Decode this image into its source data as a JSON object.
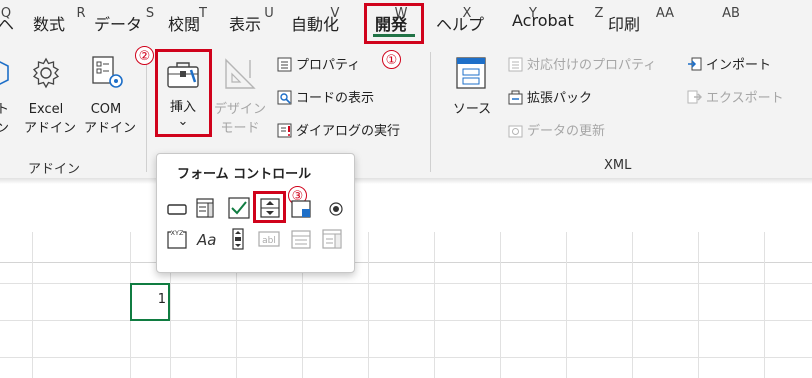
{
  "tabs": [
    {
      "label": "ヘ"
    },
    {
      "label": "数式"
    },
    {
      "label": "データ"
    },
    {
      "label": "校閲"
    },
    {
      "label": "表示"
    },
    {
      "label": "自動化"
    },
    {
      "label": "開発",
      "active": true
    },
    {
      "label": "ヘルプ"
    },
    {
      "label": "Acrobat"
    },
    {
      "label": "印刷"
    }
  ],
  "ribbon": {
    "addins_group": {
      "excel_addin": "Excel",
      "excel_addin_line2": "アドイン",
      "com_addin": "COM",
      "com_addin_line2": "アドイン",
      "label": "アドイン"
    },
    "controls_group": {
      "insert_label": "挿入",
      "insert_chevron": "⌄",
      "design_mode": "デザイン",
      "design_mode_line2": "モード",
      "properties": "プロパティ",
      "view_code": "コードの表示",
      "run_dialog": "ダイアログの実行"
    },
    "xml_group": {
      "source": "ソース",
      "map_properties": "対応付けのプロパティ",
      "expansion_packs": "拡張パック",
      "refresh_data": "データの更新",
      "import": "インポート",
      "export": "エクスポート",
      "label": "XML"
    }
  },
  "popup": {
    "title": "フォーム コントロール"
  },
  "annotations": [
    "①",
    "②",
    "③"
  ],
  "columns": [
    "Q",
    "R",
    "S",
    "T",
    "U",
    "V",
    "W",
    "X",
    "Y",
    "Z",
    "AA",
    "AB"
  ],
  "cell": {
    "value": "1"
  },
  "colors": {
    "accent": "#217346",
    "highlight": "#d0021b",
    "selection": "#107c41"
  }
}
